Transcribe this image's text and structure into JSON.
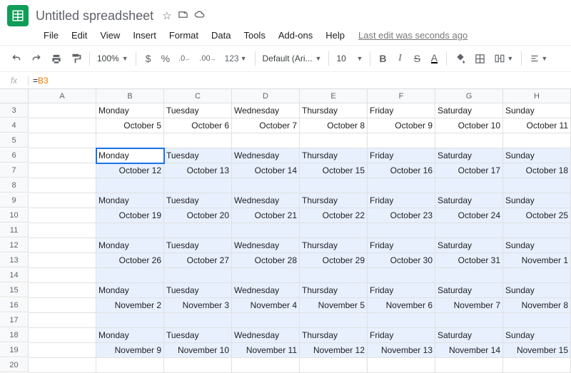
{
  "doc_title": "Untitled spreadsheet",
  "menus": [
    "File",
    "Edit",
    "View",
    "Insert",
    "Format",
    "Data",
    "Tools",
    "Add-ons",
    "Help"
  ],
  "last_edit": "Last edit was seconds ago",
  "toolbar": {
    "zoom": "100%",
    "currency": "$",
    "percent": "%",
    "dec_dec": ".0",
    "inc_dec": ".00",
    "numfmt": "123",
    "font": "Default (Ari...",
    "size": "10",
    "bold": "B",
    "italic": "I",
    "strike": "S",
    "textcolor": "A"
  },
  "formula_prefix": "=",
  "formula_ref": "B3",
  "columns": [
    "A",
    "B",
    "C",
    "D",
    "E",
    "F",
    "G",
    "H"
  ],
  "row_start": 3,
  "row_end": 20,
  "active_cell": "B6",
  "selection": {
    "r1": 6,
    "r2": 19,
    "c1": "B",
    "c2": "H"
  },
  "days": [
    "Monday",
    "Tuesday",
    "Wednesday",
    "Thursday",
    "Friday",
    "Saturday",
    "Sunday"
  ],
  "cells": {
    "3": {
      "B": "Monday",
      "C": "Tuesday",
      "D": "Wednesday",
      "E": "Thursday",
      "F": "Friday",
      "G": "Saturday",
      "H": "Sunday"
    },
    "4": {
      "B": "October 5",
      "C": "October 6",
      "D": "October 7",
      "E": "October 8",
      "F": "October 9",
      "G": "October 10",
      "H": "October 11"
    },
    "6": {
      "B": "Monday",
      "C": "Tuesday",
      "D": "Wednesday",
      "E": "Thursday",
      "F": "Friday",
      "G": "Saturday",
      "H": "Sunday"
    },
    "7": {
      "B": "October 12",
      "C": "October 13",
      "D": "October 14",
      "E": "October 15",
      "F": "October 16",
      "G": "October 17",
      "H": "October 18"
    },
    "9": {
      "B": "Monday",
      "C": "Tuesday",
      "D": "Wednesday",
      "E": "Thursday",
      "F": "Friday",
      "G": "Saturday",
      "H": "Sunday"
    },
    "10": {
      "B": "October 19",
      "C": "October 20",
      "D": "October 21",
      "E": "October 22",
      "F": "October 23",
      "G": "October 24",
      "H": "October 25"
    },
    "12": {
      "B": "Monday",
      "C": "Tuesday",
      "D": "Wednesday",
      "E": "Thursday",
      "F": "Friday",
      "G": "Saturday",
      "H": "Sunday"
    },
    "13": {
      "B": "October 26",
      "C": "October 27",
      "D": "October 28",
      "E": "October 29",
      "F": "October 30",
      "G": "October 31",
      "H": "November 1"
    },
    "15": {
      "B": "Monday",
      "C": "Tuesday",
      "D": "Wednesday",
      "E": "Thursday",
      "F": "Friday",
      "G": "Saturday",
      "H": "Sunday"
    },
    "16": {
      "B": "November 2",
      "C": "November 3",
      "D": "November 4",
      "E": "November 5",
      "F": "November 6",
      "G": "November 7",
      "H": "November 8"
    },
    "18": {
      "B": "Monday",
      "C": "Tuesday",
      "D": "Wednesday",
      "E": "Thursday",
      "F": "Friday",
      "G": "Saturday",
      "H": "Sunday"
    },
    "19": {
      "B": "November 9",
      "C": "November 10",
      "D": "November 11",
      "E": "November 12",
      "F": "November 13",
      "G": "November 14",
      "H": "November 15"
    }
  },
  "date_rows": [
    4,
    7,
    10,
    13,
    16,
    19
  ]
}
